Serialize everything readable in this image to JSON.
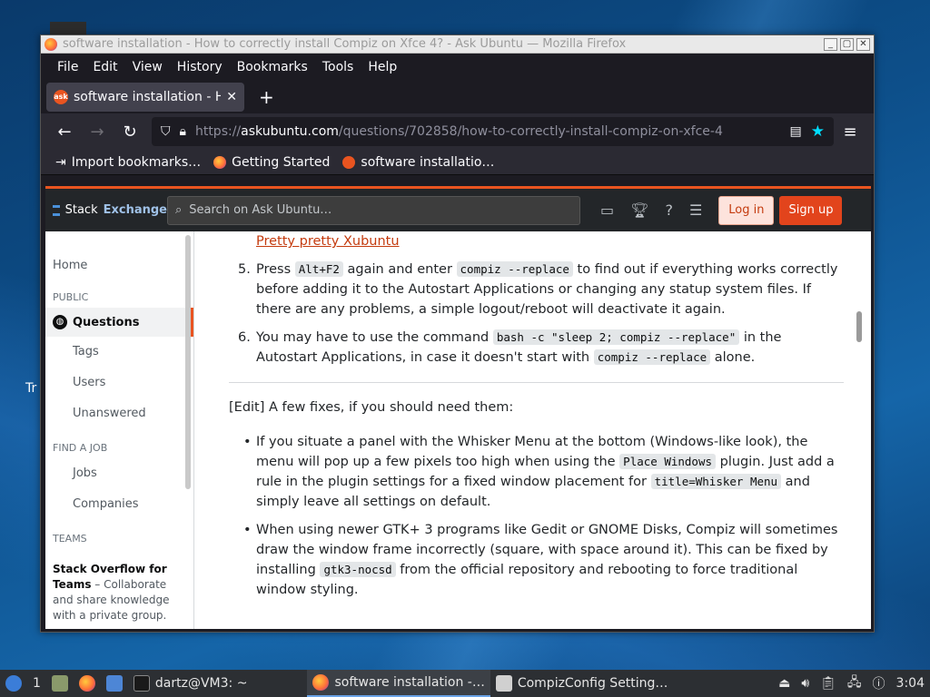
{
  "desktop": {
    "label": "Tr"
  },
  "window": {
    "title": "software installation - How to correctly install Compiz on Xfce 4? - Ask Ubuntu — Mozilla Firefox",
    "buttons": {
      "minimize": "_",
      "maximize": "▢",
      "close": "✕"
    }
  },
  "menubar": {
    "items": [
      "File",
      "Edit",
      "View",
      "History",
      "Bookmarks",
      "Tools",
      "Help"
    ]
  },
  "tab": {
    "label": "software installation - How to",
    "fav": "ask",
    "close": "✕",
    "new": "+"
  },
  "nav": {
    "url_prefix": "https://",
    "url_host": "askubuntu.com",
    "url_path": "/questions/702858/how-to-correctly-install-compiz-on-xfce-4"
  },
  "bookmarks": [
    "Import bookmarks…",
    "Getting Started",
    "software installatio…"
  ],
  "se": {
    "logo_stack": "Stack",
    "logo_exchange": "Exchange",
    "search_placeholder": "Search on Ask Ubuntu…",
    "login": "Log in",
    "signup": "Sign up"
  },
  "leftnav": {
    "home": "Home",
    "public": "PUBLIC",
    "questions": "Questions",
    "tags": "Tags",
    "users": "Users",
    "unanswered": "Unanswered",
    "find_job": "FIND A JOB",
    "jobs": "Jobs",
    "companies": "Companies",
    "teams": "TEAMS",
    "teams_title": "Stack Overflow for Teams",
    "teams_text": " – Collaborate and share knowledge with a private group."
  },
  "article": {
    "link": "Pretty pretty Xubuntu",
    "step5": {
      "num": "5.",
      "t1": "Press ",
      "c1": "Alt+F2",
      "t2": " again and enter ",
      "c2": "compiz --replace",
      "t3": " to find out if everything works correctly before adding it to the Autostart Applications or changing any statup system files. If there are any problems, a simple logout/reboot will deactivate it again."
    },
    "step6": {
      "num": "6.",
      "t1": "You may have to use the command ",
      "c1": "bash -c \"sleep 2; compiz --replace\"",
      "t2": " in the Autostart Applications, in case it doesn't start with ",
      "c2": "compiz --replace",
      "t3": " alone."
    },
    "edit": "[Edit] A few fixes, if you should need them:",
    "bullet1": {
      "t1": "If you situate a panel with the Whisker Menu at the bottom (Windows-like look), the menu will pop up a few pixels too high when using the ",
      "c1": "Place Windows",
      "t2": " plugin. Just add a rule in the plugin settings for a fixed window placement for ",
      "c2": "title=Whisker Menu",
      "t3": " and simply leave all settings on default."
    },
    "bullet2": {
      "t1": "When using newer GTK+ 3 programs like Gedit or GNOME Disks, Compiz will sometimes draw the window frame incorrectly (square, with space around it). This can be fixed by installing ",
      "c1": "gtk3-nocsd",
      "t2": " from the official repository and rebooting to force traditional window styling."
    }
  },
  "taskbar": {
    "workspace": "1",
    "terminal": "dartz@VM3: ~",
    "firefox": "software installation -…",
    "ccsm": "CompizConfig Setting…",
    "clock": "3:04"
  }
}
